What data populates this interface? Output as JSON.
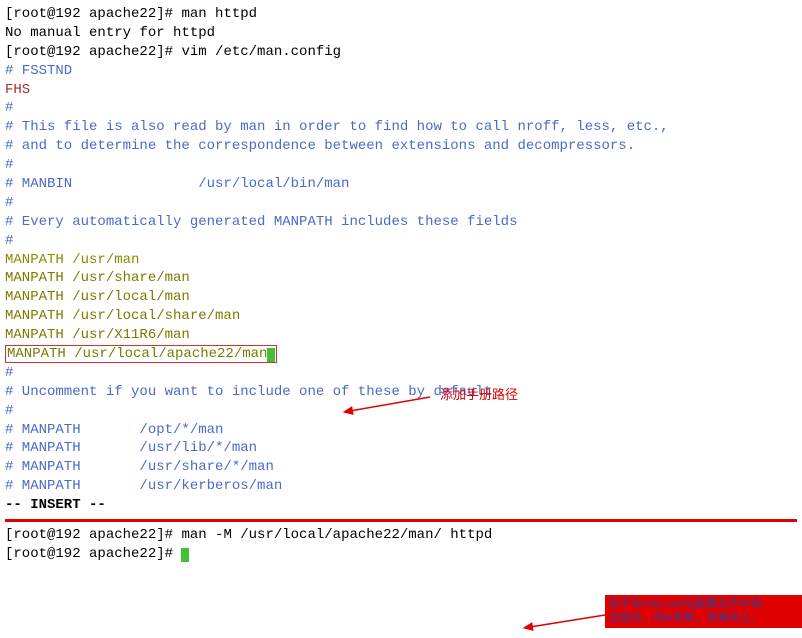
{
  "prompt1": "[root@192 apache22]# ",
  "cmd1": "man httpd",
  "err1": "No manual entry for httpd",
  "prompt2": "[root@192 apache22]# ",
  "cmd2": "vim /etc/man.config",
  "blank": "",
  "f1": "# FSSTND",
  "f2": "FHS",
  "f3": "#",
  "f4": "# This file is also read by man in order to find how to call nroff, less, etc.,",
  "f5": "# and to determine the correspondence between extensions and decompressors.",
  "f6": "#",
  "f7": "# MANBIN               /usr/local/bin/man",
  "f8": "#",
  "f9": "# Every automatically generated MANPATH includes these fields",
  "f10": "#",
  "mp1": "MANPATH /usr/man",
  "mp2": "MANPATH /usr/share/man",
  "mp3": "MANPATH /usr/local/man",
  "mp4": "MANPATH /usr/local/share/man",
  "mp5": "MANPATH /usr/X11R6/man",
  "mp6": "MANPATH /usr/local/apache22/man",
  "f11": "#",
  "f12": "# Uncomment if you want to include one of these by default",
  "f13": "#",
  "f14": "# MANPATH       /opt/*/man",
  "f15": "# MANPATH       /usr/lib/*/man",
  "f16": "# MANPATH       /usr/share/*/man",
  "f17": "# MANPATH       /usr/kerberos/man",
  "insert": "-- INSERT --",
  "prompt3": "[root@192 apache22]# ",
  "cmd3": "man -M /usr/local/apache22/man/ httpd",
  "prompt4": "[root@192 apache22]# ",
  "annot1": "添加手册路径",
  "annot2a": "如不在man.config配置文件中指",
  "annot2b": "定路径，用M参数，效果同上。"
}
